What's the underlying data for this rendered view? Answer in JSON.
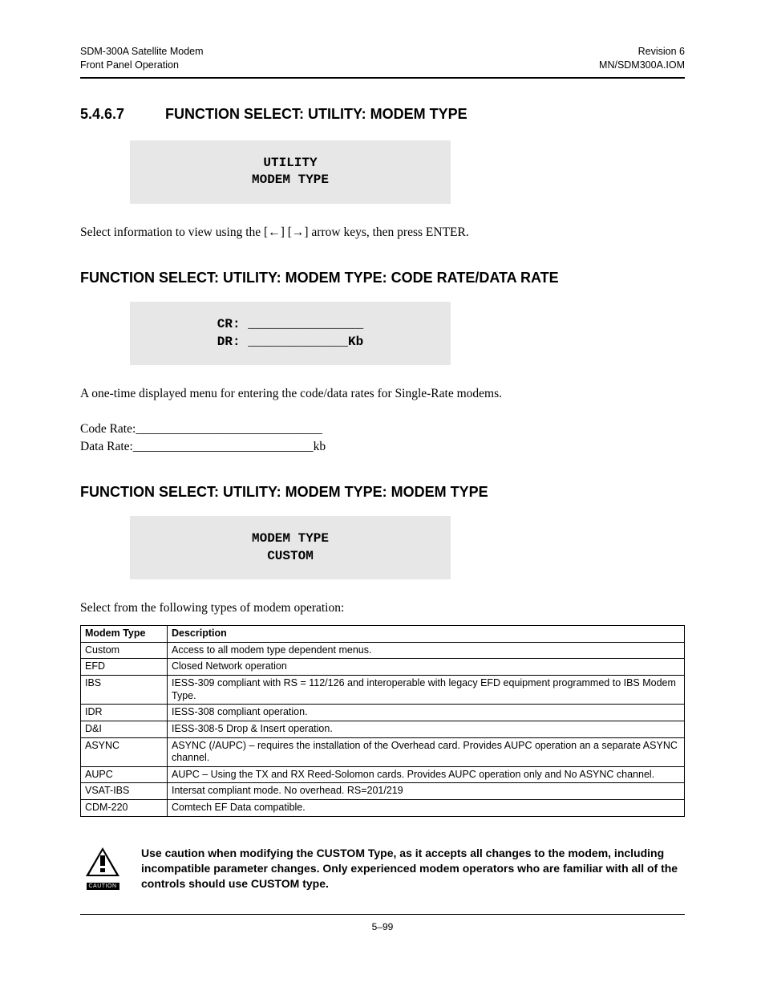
{
  "header": {
    "left1": "SDM-300A Satellite Modem",
    "left2": "Front Panel Operation",
    "right1": "Revision 6",
    "right2": "MN/SDM300A.IOM"
  },
  "section": {
    "num": "5.4.6.7",
    "title": "FUNCTION SELECT: UTILITY: MODEM TYPE"
  },
  "lcd1": "UTILITY\nMODEM TYPE",
  "para1_a": "Select information to view using the [",
  "para1_b": "] [",
  "para1_c": "] arrow keys, then press ENTER.",
  "sub1": "FUNCTION SELECT: UTILITY: MODEM TYPE: CODE RATE/DATA RATE",
  "lcd2": "CR: _______________\nDR: _____________Kb",
  "para2": "A one-time displayed menu for entering the code/data rates for Single-Rate modems.",
  "rates": {
    "cr_label": "Code Rate:",
    "cr_blank": "______________________________",
    "dr_label": "Data Rate:",
    "dr_blank": "_____________________________",
    "dr_unit": "kb"
  },
  "sub2": "FUNCTION SELECT: UTILITY: MODEM TYPE: MODEM TYPE",
  "lcd3": "MODEM TYPE\nCUSTOM",
  "para3": "Select from the following types of modem operation:",
  "table": {
    "h1": "Modem Type",
    "h2": "Description",
    "rows": [
      {
        "t": "Custom",
        "d": "Access to all modem type dependent menus."
      },
      {
        "t": "EFD",
        "d": "Closed Network operation"
      },
      {
        "t": "IBS",
        "d": "IESS-309 compliant with RS = 112/126 and interoperable with legacy EFD equipment programmed to IBS Modem Type."
      },
      {
        "t": "IDR",
        "d": "IESS-308 compliant operation."
      },
      {
        "t": "D&I",
        "d": "IESS-308-5 Drop & Insert operation."
      },
      {
        "t": "ASYNC",
        "d": "ASYNC (/AUPC) – requires the installation of the Overhead card. Provides AUPC operation an a separate ASYNC channel."
      },
      {
        "t": "AUPC",
        "d": "AUPC – Using the TX and RX Reed-Solomon cards. Provides AUPC operation only and No ASYNC channel."
      },
      {
        "t": "VSAT-IBS",
        "d": "Intersat compliant mode. No overhead. RS=201/219"
      },
      {
        "t": "CDM-220",
        "d": "Comtech EF Data compatible."
      }
    ]
  },
  "caution": {
    "label": "CAUTION",
    "text": "Use caution when modifying the CUSTOM Type, as it accepts all changes to the modem, including incompatible parameter changes. Only experienced modem operators who are familiar with all of the controls should use CUSTOM type."
  },
  "pagenum": "5–99"
}
